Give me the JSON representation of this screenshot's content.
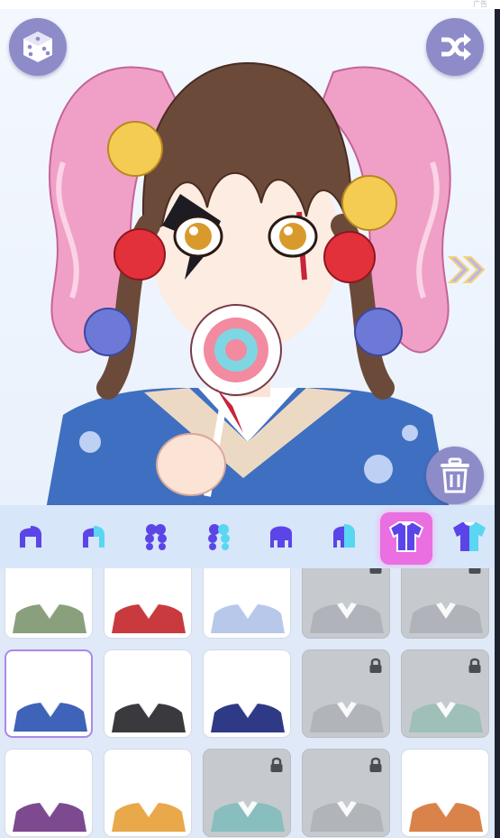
{
  "ad": {
    "label": "广告"
  },
  "stage": {
    "random_button": {
      "icon": "dice-icon"
    },
    "shuffle_button": {
      "icon": "shuffle-icon"
    },
    "next_arrow": {
      "icon": "double-chevron-right-icon"
    },
    "delete_button": {
      "icon": "trash-icon"
    }
  },
  "category_tabs": [
    {
      "name": "front-hair",
      "icon": "front-hair-icon",
      "active": false
    },
    {
      "name": "front-hair-color",
      "icon": "front-hair-color-icon",
      "active": false
    },
    {
      "name": "back-hair",
      "icon": "back-hair-icon",
      "active": false
    },
    {
      "name": "back-hair-color",
      "icon": "back-hair-color-icon",
      "active": false
    },
    {
      "name": "side-hair",
      "icon": "side-hair-icon",
      "active": false
    },
    {
      "name": "side-hair-color",
      "icon": "side-hair-color-icon",
      "active": false
    },
    {
      "name": "top",
      "icon": "shirt-icon",
      "active": true
    },
    {
      "name": "top-color",
      "icon": "shirt-color-icon",
      "active": false
    }
  ],
  "outfits": [
    {
      "locked": false,
      "selected": false,
      "color": "#8aa07c"
    },
    {
      "locked": false,
      "selected": false,
      "color": "#c93a3f"
    },
    {
      "locked": false,
      "selected": false,
      "color": "#b8c8ea"
    },
    {
      "locked": true,
      "selected": false,
      "color": "#9ea3aa"
    },
    {
      "locked": true,
      "selected": false,
      "color": "#9ea3aa"
    },
    {
      "locked": false,
      "selected": true,
      "color": "#3f63b8"
    },
    {
      "locked": false,
      "selected": false,
      "color": "#3a3a3e"
    },
    {
      "locked": false,
      "selected": false,
      "color": "#2e3a86"
    },
    {
      "locked": true,
      "selected": false,
      "color": "#a0a4aa"
    },
    {
      "locked": true,
      "selected": false,
      "color": "#7fb7a8"
    },
    {
      "locked": false,
      "selected": false,
      "color": "#7d4a8f"
    },
    {
      "locked": false,
      "selected": false,
      "color": "#e9a84a"
    },
    {
      "locked": true,
      "selected": false,
      "color": "#58b4b0"
    },
    {
      "locked": true,
      "selected": false,
      "color": "#a0a4aa"
    },
    {
      "locked": false,
      "selected": false,
      "color": "#d9834a"
    }
  ],
  "colors": {
    "accent": "#ea6fe0",
    "icon_purple": "#5b45e8",
    "icon_cyan": "#59d6f1",
    "button": "#8e8bc9"
  }
}
